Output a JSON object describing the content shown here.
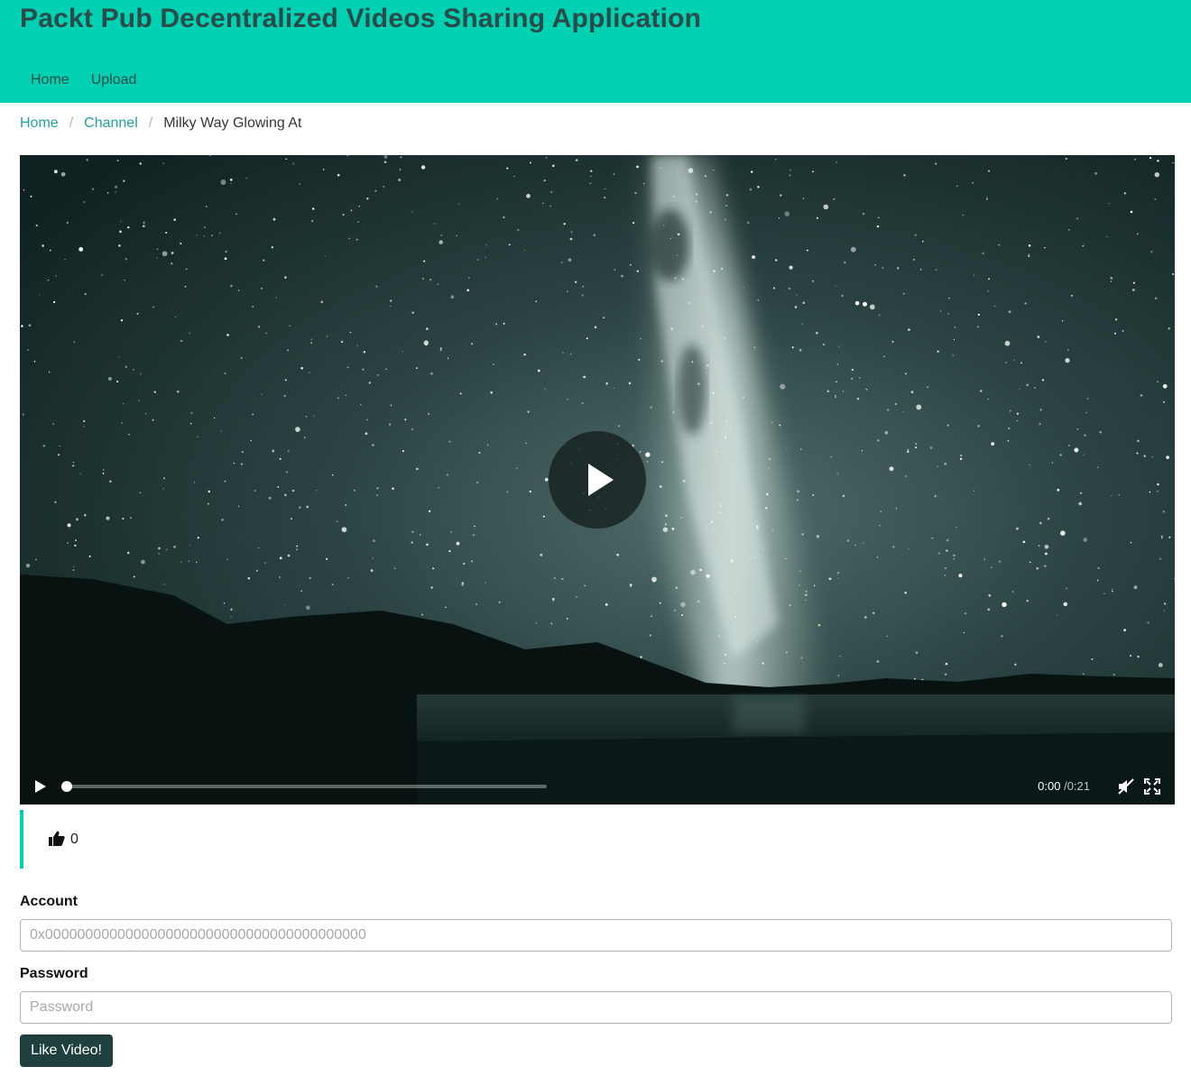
{
  "header": {
    "title": "Packt Pub Decentralized Videos Sharing Application",
    "background_color": "#00d1b2"
  },
  "nav": {
    "items": [
      {
        "label": "Home"
      },
      {
        "label": "Upload"
      }
    ]
  },
  "breadcrumb": {
    "items": [
      {
        "label": "Home"
      },
      {
        "label": "Channel"
      }
    ],
    "current": "Milky Way Glowing At"
  },
  "video": {
    "poster": "milky way night sky over mountains and lake",
    "current_time": "0:00",
    "separator": "/",
    "duration": "0:21",
    "progress": 0,
    "muted": true,
    "icons": {
      "big_play": "play-icon",
      "play": "play-icon",
      "mute": "volume-muted-icon",
      "fullscreen": "fullscreen-icon"
    }
  },
  "likes": {
    "icon": "thumbs-up-icon",
    "count": "0"
  },
  "form": {
    "account": {
      "label": "Account",
      "value": "",
      "placeholder": "0x0000000000000000000000000000000000000000"
    },
    "password": {
      "label": "Password",
      "value": "",
      "placeholder": "Password"
    },
    "submit_label": "Like Video!"
  },
  "colors": {
    "accent": "#00d1b2",
    "link": "#1fa3a0",
    "button": "#1f403f",
    "title_text": "#2b4a4a"
  }
}
